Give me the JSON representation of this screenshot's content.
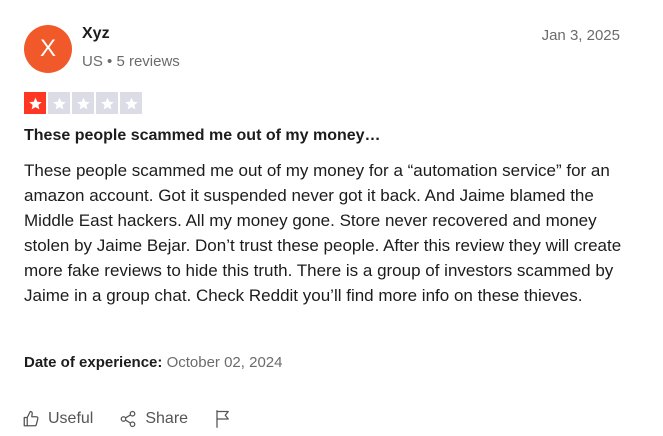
{
  "review": {
    "avatar_letter": "X",
    "avatar_color": "#f1592a",
    "username": "Xyz",
    "country": "US",
    "separator": "•",
    "review_count": "5 reviews",
    "date": "Jan 3, 2025",
    "rating": 1,
    "max_rating": 5,
    "star_filled_color": "#ff3722",
    "star_empty_color": "#dcdce6",
    "title": "These people scammed me out of my money…",
    "body": "These people scammed me out of my money for a “automation service” for an amazon account. Got it suspended never got it back. And Jaime blamed the Middle East hackers. All my money gone. Store never recovered and money stolen by Jaime Bejar. Don’t trust these people. After this review they will create more fake reviews to hide this truth. There is a group of investors scammed by Jaime in a group chat. Check Reddit you’ll find more info on these thieves.",
    "experience_label": "Date of experience:",
    "experience_date": "October 02, 2024"
  },
  "actions": {
    "useful_label": "Useful",
    "useful_icon": "thumbs-up-icon",
    "share_label": "Share",
    "share_icon": "share-icon",
    "report_icon": "flag-icon"
  }
}
